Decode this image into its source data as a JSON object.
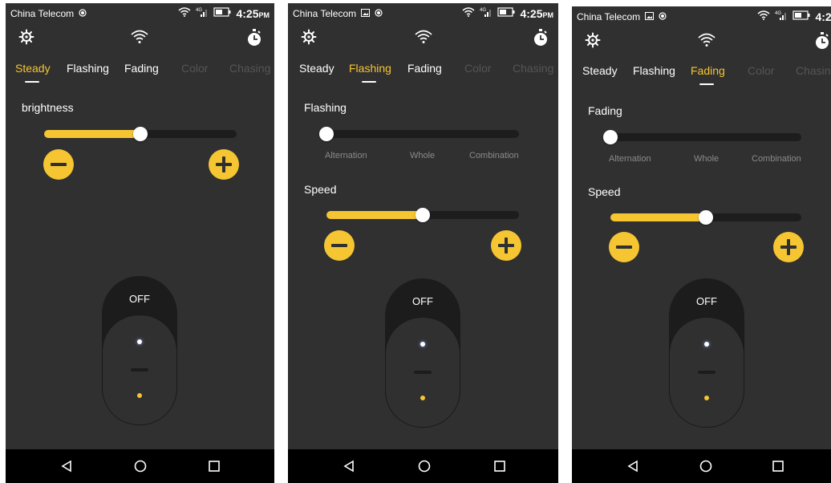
{
  "status": {
    "carrier": "China Telecom",
    "time": "4:25",
    "time_suffix": "PM",
    "network": "4G"
  },
  "tabs": [
    "Steady",
    "Flashing",
    "Fading",
    "Color",
    "Chasing"
  ],
  "screens": [
    {
      "active_tab": "Steady",
      "section_label": "brightness",
      "brightness_level": 0.5
    },
    {
      "active_tab": "Flashing",
      "mode_section_label": "Flashing",
      "modes": [
        "Alternation",
        "Whole",
        "Combination"
      ],
      "selected_mode": "Alternation",
      "speed_label": "Speed",
      "speed_level": 0.5
    },
    {
      "active_tab": "Fading",
      "mode_section_label": "Fading",
      "modes": [
        "Alternation",
        "Whole",
        "Combination"
      ],
      "selected_mode": "Alternation",
      "speed_label": "Speed",
      "speed_level": 0.5
    }
  ],
  "power_switch": {
    "label": "OFF"
  },
  "colors": {
    "background": "#303030",
    "accent": "#f6c532",
    "track": "#1d1d1d",
    "navbar": "#000000",
    "disabled_tab": "#555555"
  },
  "icons": {
    "settings": "settings-icon",
    "wifi": "wifi-icon",
    "timer": "timer-icon",
    "back": "back-icon",
    "home": "home-icon",
    "recents": "recents-icon"
  }
}
